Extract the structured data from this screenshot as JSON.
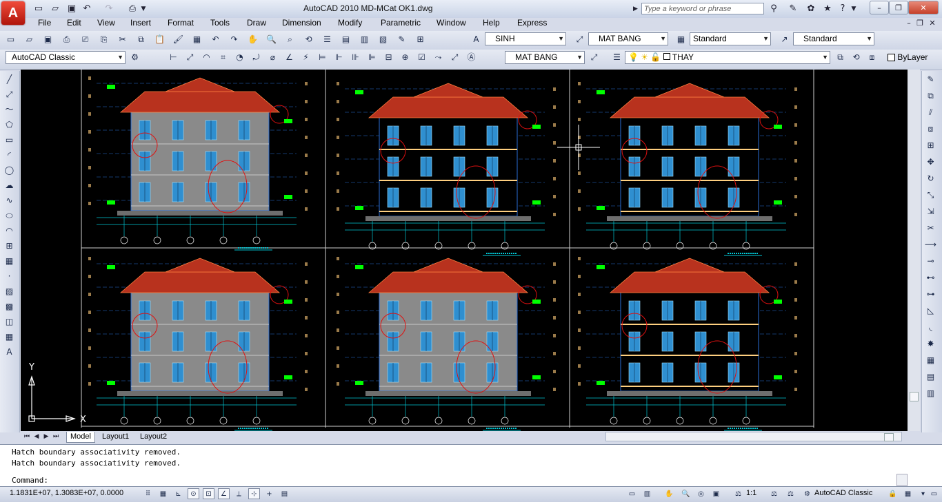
{
  "app": {
    "logo_letter": "A",
    "title": "AutoCAD 2010     MD-MCat OK1.dwg",
    "search_placeholder": "Type a keyword or phrase"
  },
  "quick_access": [
    "new-icon",
    "open-icon",
    "save-icon",
    "undo-icon",
    "redo-icon",
    "plot-icon"
  ],
  "menu": [
    "File",
    "Edit",
    "View",
    "Insert",
    "Format",
    "Tools",
    "Draw",
    "Dimension",
    "Modify",
    "Parametric",
    "Window",
    "Help",
    "Express"
  ],
  "toolbar": {
    "text_style": "SINH",
    "dim_style": "MAT BANG",
    "table_style": "Standard",
    "multileader_style": "Standard",
    "workspace": "AutoCAD Classic",
    "dim_style_2": "MAT BANG",
    "layer": "THAY",
    "color": "ByLayer"
  },
  "tabs": {
    "model": "Model",
    "layout1": "Layout1",
    "layout2": "Layout2"
  },
  "command": {
    "history": [
      "Hatch boundary associativity removed.",
      "Hatch boundary associativity removed."
    ],
    "prompt": "Command:"
  },
  "status": {
    "coordinates": "1.1831E+07, 1.3083E+07, 0.0000",
    "annotation_scale": "1:1",
    "workspace": "AutoCAD Classic"
  },
  "ucs": {
    "x_label": "X",
    "y_label": "Y"
  },
  "colors": {
    "canvas": "#000000",
    "roof": "#b8321e",
    "wall": "#8a8a8a",
    "window": "#2f8fd0",
    "grid_line": "#2a6ed6",
    "dimension": "#00c8d6",
    "annotation": "#00ff00",
    "cloud": "#e01010"
  }
}
